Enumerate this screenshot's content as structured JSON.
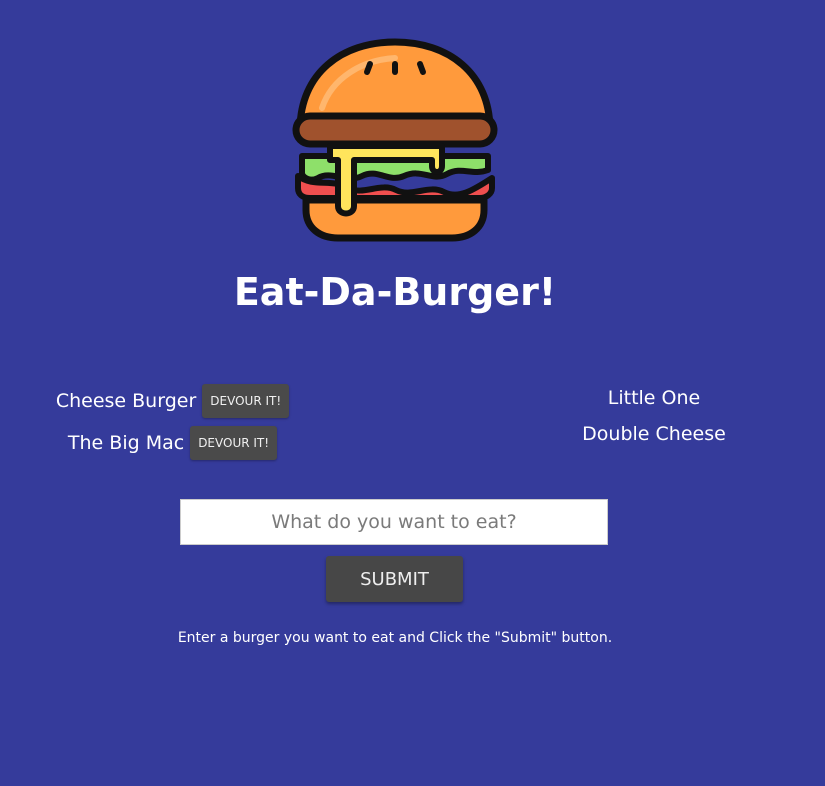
{
  "logo": {
    "icon": "hamburger-icon"
  },
  "title": "Eat-Da-Burger!",
  "uneaten_burgers": [
    {
      "name": "Cheese Burger",
      "button_label": "DEVOUR IT!"
    },
    {
      "name": "The Big Mac",
      "button_label": "DEVOUR IT!"
    }
  ],
  "eaten_burgers": [
    {
      "name": "Little One"
    },
    {
      "name": "Double Cheese"
    }
  ],
  "form": {
    "input_value": "",
    "input_placeholder": "What do you want to eat?",
    "submit_label": "SUBMIT"
  },
  "instructions": "Enter a burger you want to eat and Click the \"Submit\" button.",
  "colors": {
    "background": "#353b9b",
    "text": "#ffffff",
    "button": "#474747",
    "bun": "#ff9a3c",
    "patty": "#a0522d",
    "cheese": "#ffe55c",
    "lettuce": "#8ee06a",
    "tomato": "#f04f4f"
  }
}
